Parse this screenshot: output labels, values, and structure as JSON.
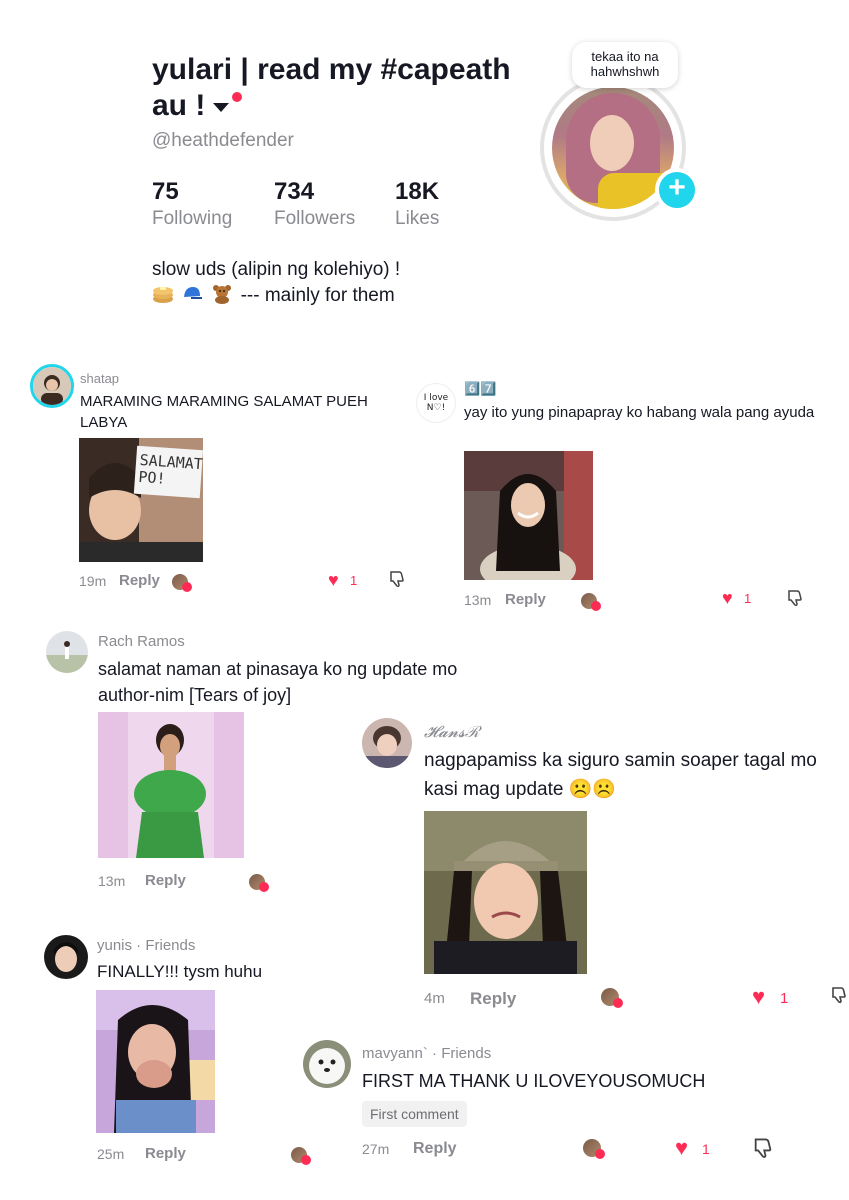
{
  "profile": {
    "name": "yulari | read my #capeath au !",
    "handle": "@heathdefender",
    "stats": [
      {
        "value": "75",
        "label": "Following"
      },
      {
        "value": "734",
        "label": "Followers"
      },
      {
        "value": "18K",
        "label": "Likes"
      }
    ],
    "bio_line1": "slow uds (alipin ng kolehiyo) !",
    "bio_line2": "--- mainly for them",
    "bubble_text": "tekaa ito na hahwhshwh",
    "plus_glyph": "+"
  },
  "comments": [
    {
      "user": "shatap",
      "text": "MARAMING MARAMING SALAMAT PUEH LABYA",
      "image_text": "SALAMAT PO!",
      "time": "19m",
      "reply": "Reply",
      "likes": "1"
    },
    {
      "user": "6️⃣7️⃣",
      "avatar_text": "I love N♡!",
      "text": "yay ito yung pinapapray ko habang wala pang ayuda",
      "time": "13m",
      "reply": "Reply",
      "likes": "1"
    },
    {
      "user": "Rach Ramos",
      "text": "salamat naman at pinasaya ko ng update mo author-nim [Tears of joy]",
      "time": "13m",
      "reply": "Reply"
    },
    {
      "user": "𝓗𝓪𝓷𝓼ℛ",
      "text": "nagpapamiss ka siguro samin soaper tagal mo kasi mag update ☹️☹️",
      "time": "4m",
      "reply": "Reply",
      "likes": "1"
    },
    {
      "user": "yunis · Friends",
      "text": "FINALLY!!! tysm huhu",
      "time": "25m",
      "reply": "Reply"
    },
    {
      "user": "mavyann` · Friends",
      "text": "FIRST MA THANK U ILOVEYOUSOMUCH",
      "tag": "First comment",
      "time": "27m",
      "reply": "Reply",
      "likes": "1"
    }
  ],
  "colors": {
    "accent": "#fe2c55",
    "plus": "#20d5ec",
    "muted": "#8a8b91"
  }
}
